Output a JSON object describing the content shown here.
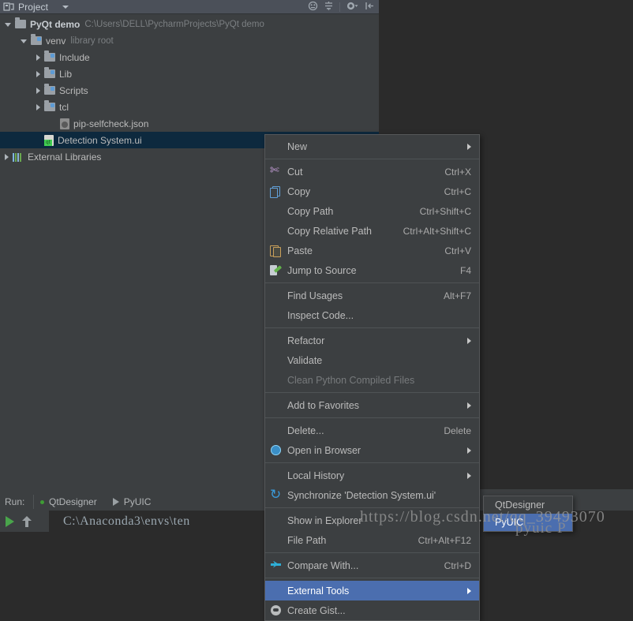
{
  "window": {
    "panel_title": "Project",
    "toolbar_icons": [
      "target-icon",
      "collapse-all-icon",
      "settings-gear-icon",
      "hide-panel-icon"
    ]
  },
  "tree": {
    "nodes": [
      {
        "label": "PyQt demo",
        "detail": "C:\\Users\\DELL\\PycharmProjects\\PyQt demo",
        "icon": "folder-icon",
        "depth": 0,
        "state": "expanded",
        "bold": true,
        "selected": false
      },
      {
        "label": "venv",
        "detail": "library root",
        "icon": "folder-icon",
        "depth": 1,
        "state": "expanded",
        "bold": false,
        "selected": false
      },
      {
        "label": "Include",
        "detail": "",
        "icon": "folder-icon",
        "depth": 2,
        "state": "collapsed",
        "bold": false,
        "selected": false
      },
      {
        "label": "Lib",
        "detail": "",
        "icon": "folder-icon",
        "depth": 2,
        "state": "collapsed",
        "bold": false,
        "selected": false
      },
      {
        "label": "Scripts",
        "detail": "",
        "icon": "folder-icon",
        "depth": 2,
        "state": "collapsed",
        "bold": false,
        "selected": false
      },
      {
        "label": "tcl",
        "detail": "",
        "icon": "folder-icon",
        "depth": 2,
        "state": "collapsed",
        "bold": false,
        "selected": false
      },
      {
        "label": "pip-selfcheck.json",
        "detail": "",
        "icon": "json-file-icon",
        "depth": 3,
        "state": "leaf",
        "bold": false,
        "selected": false
      },
      {
        "label": "Detection System.ui",
        "detail": "",
        "icon": "qt-ui-file-icon",
        "depth": 2,
        "state": "leaf",
        "bold": false,
        "selected": true
      },
      {
        "label": "External Libraries",
        "detail": "",
        "icon": "libraries-icon",
        "depth": 0,
        "state": "collapsed",
        "bold": false,
        "selected": false
      }
    ]
  },
  "context_menu": {
    "items": [
      {
        "label": "New",
        "accel": "N",
        "shortcut": "",
        "icon": "",
        "submenu": true,
        "disabled": false,
        "highlighted": false,
        "separator_after": true
      },
      {
        "label": "Cut",
        "accel": "t",
        "shortcut": "Ctrl+X",
        "icon": "scissors-icon",
        "submenu": false,
        "disabled": false,
        "highlighted": false,
        "separator_after": false
      },
      {
        "label": "Copy",
        "accel": "C",
        "shortcut": "Ctrl+C",
        "icon": "copy-icon",
        "submenu": false,
        "disabled": false,
        "highlighted": false,
        "separator_after": false
      },
      {
        "label": "Copy Path",
        "accel": "o",
        "shortcut": "Ctrl+Shift+C",
        "icon": "",
        "submenu": false,
        "disabled": false,
        "highlighted": false,
        "separator_after": false
      },
      {
        "label": "Copy Relative Path",
        "accel": "y",
        "shortcut": "Ctrl+Alt+Shift+C",
        "icon": "",
        "submenu": false,
        "disabled": false,
        "highlighted": false,
        "separator_after": false
      },
      {
        "label": "Paste",
        "accel": "P",
        "shortcut": "Ctrl+V",
        "icon": "paste-icon",
        "submenu": false,
        "disabled": false,
        "highlighted": false,
        "separator_after": false
      },
      {
        "label": "Jump to Source",
        "accel": "",
        "shortcut": "F4",
        "icon": "jump-to-source-icon",
        "submenu": false,
        "disabled": false,
        "highlighted": false,
        "separator_after": true
      },
      {
        "label": "Find Usages",
        "accel": "U",
        "shortcut": "Alt+F7",
        "icon": "",
        "submenu": false,
        "disabled": false,
        "highlighted": false,
        "separator_after": false
      },
      {
        "label": "Inspect Code...",
        "accel": "I",
        "shortcut": "",
        "icon": "",
        "submenu": false,
        "disabled": false,
        "highlighted": false,
        "separator_after": true
      },
      {
        "label": "Refactor",
        "accel": "R",
        "shortcut": "",
        "icon": "",
        "submenu": true,
        "disabled": false,
        "highlighted": false,
        "separator_after": false
      },
      {
        "label": "Validate",
        "accel": "V",
        "shortcut": "",
        "icon": "",
        "submenu": false,
        "disabled": false,
        "highlighted": false,
        "separator_after": false
      },
      {
        "label": "Clean Python Compiled Files",
        "accel": "",
        "shortcut": "",
        "icon": "",
        "submenu": false,
        "disabled": true,
        "highlighted": false,
        "separator_after": true
      },
      {
        "label": "Add to Favorites",
        "accel": "F",
        "shortcut": "",
        "icon": "",
        "submenu": true,
        "disabled": false,
        "highlighted": false,
        "separator_after": true
      },
      {
        "label": "Delete...",
        "accel": "D",
        "shortcut": "Delete",
        "icon": "",
        "submenu": false,
        "disabled": false,
        "highlighted": false,
        "separator_after": false
      },
      {
        "label": "Open in Browser",
        "accel": "B",
        "shortcut": "",
        "icon": "globe-icon",
        "submenu": true,
        "disabled": false,
        "highlighted": false,
        "separator_after": true
      },
      {
        "label": "Local History",
        "accel": "H",
        "shortcut": "",
        "icon": "",
        "submenu": true,
        "disabled": false,
        "highlighted": false,
        "separator_after": false
      },
      {
        "label": "Synchronize 'Detection System.ui'",
        "accel": "",
        "shortcut": "",
        "icon": "sync-icon",
        "submenu": false,
        "disabled": false,
        "highlighted": false,
        "separator_after": true
      },
      {
        "label": "Show in Explorer",
        "accel": "",
        "shortcut": "",
        "icon": "",
        "submenu": false,
        "disabled": false,
        "highlighted": false,
        "separator_after": false
      },
      {
        "label": "File Path",
        "accel": "P",
        "shortcut": "Ctrl+Alt+F12",
        "icon": "",
        "submenu": false,
        "disabled": false,
        "highlighted": false,
        "separator_after": true
      },
      {
        "label": "Compare With...",
        "accel": "",
        "shortcut": "Ctrl+D",
        "icon": "compare-icon",
        "submenu": false,
        "disabled": false,
        "highlighted": false,
        "separator_after": true
      },
      {
        "label": "External Tools",
        "accel": "",
        "shortcut": "",
        "icon": "",
        "submenu": true,
        "disabled": false,
        "highlighted": true,
        "separator_after": false
      },
      {
        "label": "Create Gist...",
        "accel": "",
        "shortcut": "",
        "icon": "gist-icon",
        "submenu": false,
        "disabled": false,
        "highlighted": false,
        "separator_after": false
      }
    ]
  },
  "submenu": {
    "items": [
      {
        "label": "QtDesigner",
        "highlighted": false
      },
      {
        "label": "PyUIC",
        "highlighted": true
      }
    ]
  },
  "run_panel": {
    "run_label": "Run:",
    "tabs": [
      {
        "label": "QtDesigner",
        "status_icon": "green-dot-icon"
      },
      {
        "label": "PyUIC",
        "status_icon": "play-icon"
      }
    ],
    "console_text": "C:\\Anaconda3\\envs\\ten"
  },
  "watermark": {
    "line1": "https://blog.csdn.net/qq_39493070",
    "line2": "pyuic P"
  },
  "colors": {
    "panel_bg": "#3c3f41",
    "editor_bg": "#2b2b2b",
    "header_bg": "#4b5059",
    "selection_bg": "#0d293e",
    "menu_highlight": "#4b6eaf",
    "text": "#bbbbbb",
    "dim_text": "#7b7f82",
    "green_accent": "#41cd52"
  }
}
